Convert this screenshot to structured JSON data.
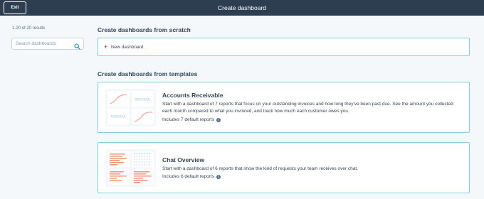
{
  "header": {
    "exit_label": "Exit",
    "title": "Create dashboard"
  },
  "sidebar": {
    "results_count": "1-20 of 20 results",
    "search_placeholder": "Search dashboards",
    "search_value": ""
  },
  "scratch": {
    "title": "Create dashboards from scratch",
    "new_dashboard_icon": "+",
    "new_dashboard_label": "New dashboard"
  },
  "templates": {
    "title": "Create dashboards from templates",
    "items": [
      {
        "name": "Accounts Receivable",
        "description": "Start with a dashboard of 7 reports that focus on your outstanding invoices and how long they've been past due. See the amount you collected each month compared to what you invoiced, and track how much each customer owes you.",
        "reports": "Includes 7 default reports",
        "thumbnail_icon": "line-chart-grid-thumbnail"
      },
      {
        "name": "Chat Overview",
        "description": "Start with a dashboard of 6 reports that show the kind of requests your team receives over chat.",
        "reports": "Includes 6 default reports",
        "thumbnail_icon": "bar-chart-table-thumbnail"
      }
    ]
  },
  "colors": {
    "header_bg": "#2d3e50",
    "card_border": "#7fd1de",
    "chart_orange": "#ff8f73",
    "chart_teal": "#7fd1de"
  }
}
